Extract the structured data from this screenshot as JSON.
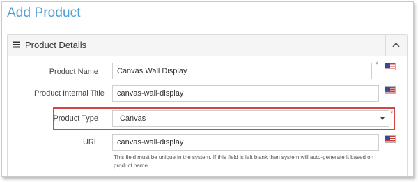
{
  "page": {
    "title": "Add Product"
  },
  "panel": {
    "title": "Product Details"
  },
  "fields": {
    "product_name": {
      "label": "Product Name",
      "value": "Canvas Wall Display",
      "required": "*"
    },
    "internal_title": {
      "label": "Product Internal Title",
      "value": "canvas-wall-display"
    },
    "product_type": {
      "label": "Product Type",
      "value": "Canvas",
      "required": "*"
    },
    "url": {
      "label": "URL",
      "value": "canvas-wall-display",
      "help": "This field must be unique in the system. If this field is left blank then system will auto-generate it based on product name."
    }
  },
  "colors": {
    "title": "#4f9fd4",
    "highlight": "#d64545",
    "required": "#d9534f"
  },
  "icons": {
    "panel": "list-icon",
    "collapse": "chevron-up-icon",
    "language": "us-flag-icon",
    "select": "caret-down-icon"
  }
}
